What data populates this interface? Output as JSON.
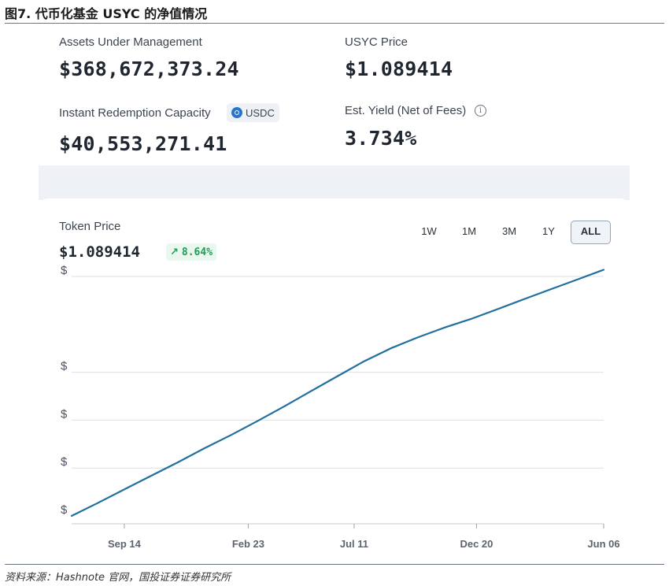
{
  "figure_title": "图7. 代币化基金 USYC 的净值情况",
  "source_note": "资料来源：Hashnote 官网，国投证券证券研究所",
  "stats": {
    "aum_label": "Assets Under Management",
    "aum_value": "$368,672,373.24",
    "price_label": "USYC Price",
    "price_value": "$1.089414",
    "redemption_label": "Instant Redemption Capacity",
    "redemption_badge": "USDC",
    "redemption_value": "$40,553,271.41",
    "yield_label": "Est. Yield (Net of Fees)",
    "yield_info": "i",
    "yield_value": "3.734%"
  },
  "token_panel": {
    "label": "Token Price",
    "value": "$1.089414",
    "change": "8.64%",
    "change_icon": "arrow-up-right-icon",
    "ranges": [
      "1W",
      "1M",
      "3M",
      "1Y",
      "ALL"
    ],
    "active_range": "ALL"
  },
  "colors": {
    "line": "#1f6f9f",
    "positive": "#1f9d55",
    "grid": "#dcdfe4"
  },
  "chart_data": {
    "type": "line",
    "title": "",
    "xlabel": "",
    "ylabel": "",
    "x_tick_labels": [
      "Sep 14",
      "Feb 23",
      "Jul 11",
      "Dec 20",
      "Jun 06"
    ],
    "y_tick_labels": [
      "$",
      "$",
      "$",
      "$",
      "$"
    ],
    "grid": "horizontal",
    "series": [
      {
        "values": [
          [
            0.0,
            0.0
          ],
          [
            0.05,
            0.055
          ],
          [
            0.1,
            0.112
          ],
          [
            0.15,
            0.168
          ],
          [
            0.2,
            0.224
          ],
          [
            0.25,
            0.283
          ],
          [
            0.3,
            0.338
          ],
          [
            0.35,
            0.397
          ],
          [
            0.4,
            0.458
          ],
          [
            0.45,
            0.521
          ],
          [
            0.5,
            0.584
          ],
          [
            0.55,
            0.646
          ],
          [
            0.6,
            0.7
          ],
          [
            0.65,
            0.745
          ],
          [
            0.7,
            0.786
          ],
          [
            0.75,
            0.822
          ],
          [
            0.8,
            0.863
          ],
          [
            0.85,
            0.905
          ],
          [
            0.9,
            0.946
          ],
          [
            0.95,
            0.987
          ],
          [
            1.0,
            1.028
          ]
        ]
      }
    ],
    "note_x": "fraction of time span from start to Jun 06",
    "note_y": "relative price level (gridline spacing = 0.2); y-axis tick values not printed"
  }
}
